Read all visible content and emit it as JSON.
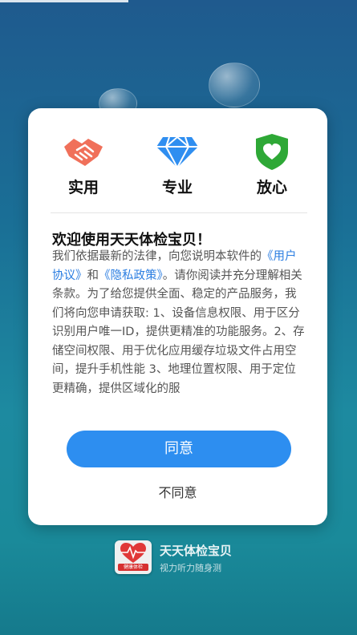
{
  "dialog": {
    "features": [
      {
        "label": "实用",
        "icon": "handshake-icon"
      },
      {
        "label": "专业",
        "icon": "diamond-icon"
      },
      {
        "label": "放心",
        "icon": "shield-heart-icon"
      }
    ],
    "title": "欢迎使用天天体检宝贝！",
    "body_prefix": "我们依据最新的法律，向您说明本软件的",
    "user_agreement_link": "《用户协议》",
    "body_and": "和",
    "privacy_policy_link": "《隐私政策》",
    "body_rest": "。请你阅读并充分理解相关条款。为了给您提供全面、稳定的产品服务，我们将向您申请获取: 1、设备信息权限、用于区分识别用户唯一ID，提供更精准的功能服务。2、存储空间权限、用于优化应用缓存垃圾文件占用空间，提升手机性能 3、地理位置权限、用于定位更精确，提供区域化的服",
    "agree_label": "同意",
    "disagree_label": "不同意"
  },
  "brand": {
    "logo_text": "健康体检",
    "name": "天天体检宝贝",
    "slogan": "视力听力随身测"
  },
  "colors": {
    "accent": "#2d8ef0",
    "link": "#2a7de1",
    "handshake": "#f0705a",
    "diamond": "#2f8ef0",
    "shield": "#2ea836"
  }
}
